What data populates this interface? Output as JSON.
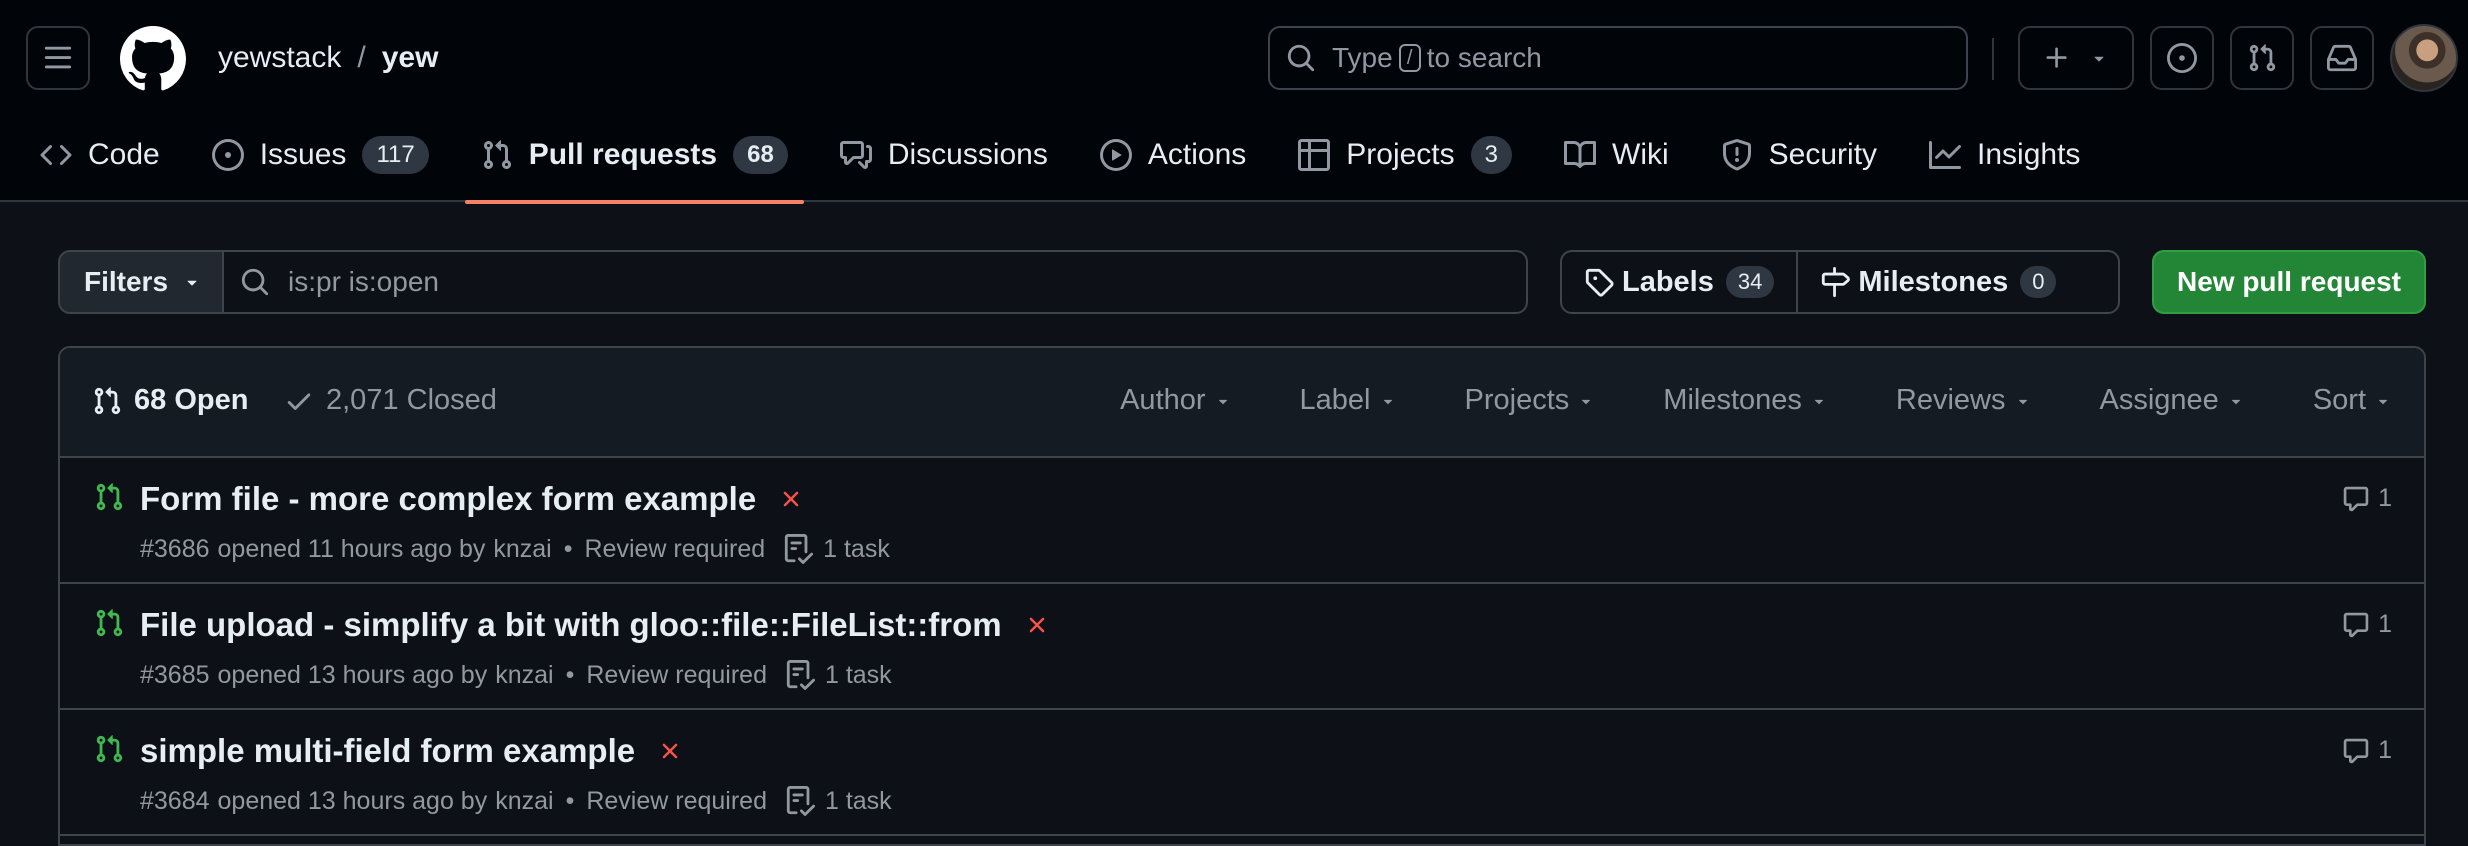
{
  "header": {
    "owner": "yewstack",
    "separator": "/",
    "repo": "yew",
    "search_prefix": "Type",
    "search_key": "/",
    "search_suffix": "to search"
  },
  "tabs": [
    {
      "label": "Code",
      "icon": "code-icon"
    },
    {
      "label": "Issues",
      "count": "117",
      "icon": "issue-icon"
    },
    {
      "label": "Pull requests",
      "count": "68",
      "icon": "pull-request-icon",
      "active": true
    },
    {
      "label": "Discussions",
      "icon": "discussions-icon"
    },
    {
      "label": "Actions",
      "icon": "play-icon"
    },
    {
      "label": "Projects",
      "count": "3",
      "icon": "table-icon"
    },
    {
      "label": "Wiki",
      "icon": "book-icon"
    },
    {
      "label": "Security",
      "icon": "shield-icon"
    },
    {
      "label": "Insights",
      "icon": "graph-icon"
    }
  ],
  "filter_bar": {
    "filters_label": "Filters",
    "query": "is:pr is:open",
    "labels_label": "Labels",
    "labels_count": "34",
    "milestones_label": "Milestones",
    "milestones_count": "0",
    "new_pr_label": "New pull request"
  },
  "list_header": {
    "open_label": "68 Open",
    "closed_label": "2,071 Closed",
    "sorts": [
      "Author",
      "Label",
      "Projects",
      "Milestones",
      "Reviews",
      "Assignee",
      "Sort"
    ]
  },
  "pull_requests": [
    {
      "title": "Form file - more complex form example",
      "number": "#3686",
      "opened": "opened 11 hours ago by",
      "author": "knzai",
      "review": "Review required",
      "tasks": "1 task",
      "comments": "1"
    },
    {
      "title": "File upload - simplify a bit with gloo::file::FileList::from",
      "number": "#3685",
      "opened": "opened 13 hours ago by",
      "author": "knzai",
      "review": "Review required",
      "tasks": "1 task",
      "comments": "1"
    },
    {
      "title": "simple multi-field form example",
      "number": "#3684",
      "opened": "opened 13 hours ago by",
      "author": "knzai",
      "review": "Review required",
      "tasks": "1 task",
      "comments": "1"
    }
  ],
  "colors": {
    "background": "#0d1117",
    "header_bg": "#010409",
    "accent_tab": "#f78166",
    "open_green": "#3fb950",
    "button_green": "#238636",
    "fail_red": "#f85149",
    "muted_text": "#9198a1"
  }
}
